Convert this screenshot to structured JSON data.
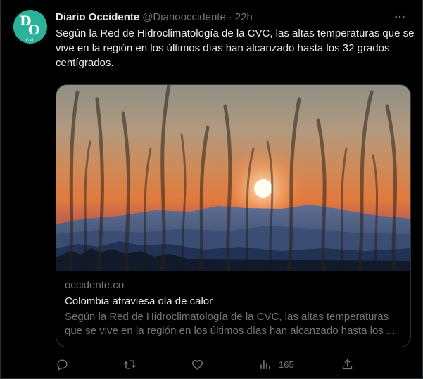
{
  "tweet": {
    "author_name": "Diario Occidente",
    "author_handle": "@Diariooccidente",
    "separator": "·",
    "time": "22h",
    "text": "Según la Red de Hidroclimatología de la CVC, las altas temperaturas que se vive en la región en los últimos días han alcanzado hasta los 32 grados centígrados.",
    "avatar_text": "Cali"
  },
  "card": {
    "domain": "occidente.co",
    "title": "Colombia atraviesa ola de calor",
    "description": "Según la Red de Hidroclimatología de la CVC, las altas temperaturas que se vive en la región en los últimos días han alcanzado hasta los ..."
  },
  "actions": {
    "views_count": "165"
  },
  "colors": {
    "background": "#000000",
    "text_primary": "#e7e9ea",
    "text_secondary": "#71767b",
    "border": "#2f3336",
    "avatar_bg": "#2bb39a"
  },
  "icons": [
    "more-icon",
    "reply-icon",
    "retweet-icon",
    "like-icon",
    "views-icon",
    "share-icon"
  ]
}
